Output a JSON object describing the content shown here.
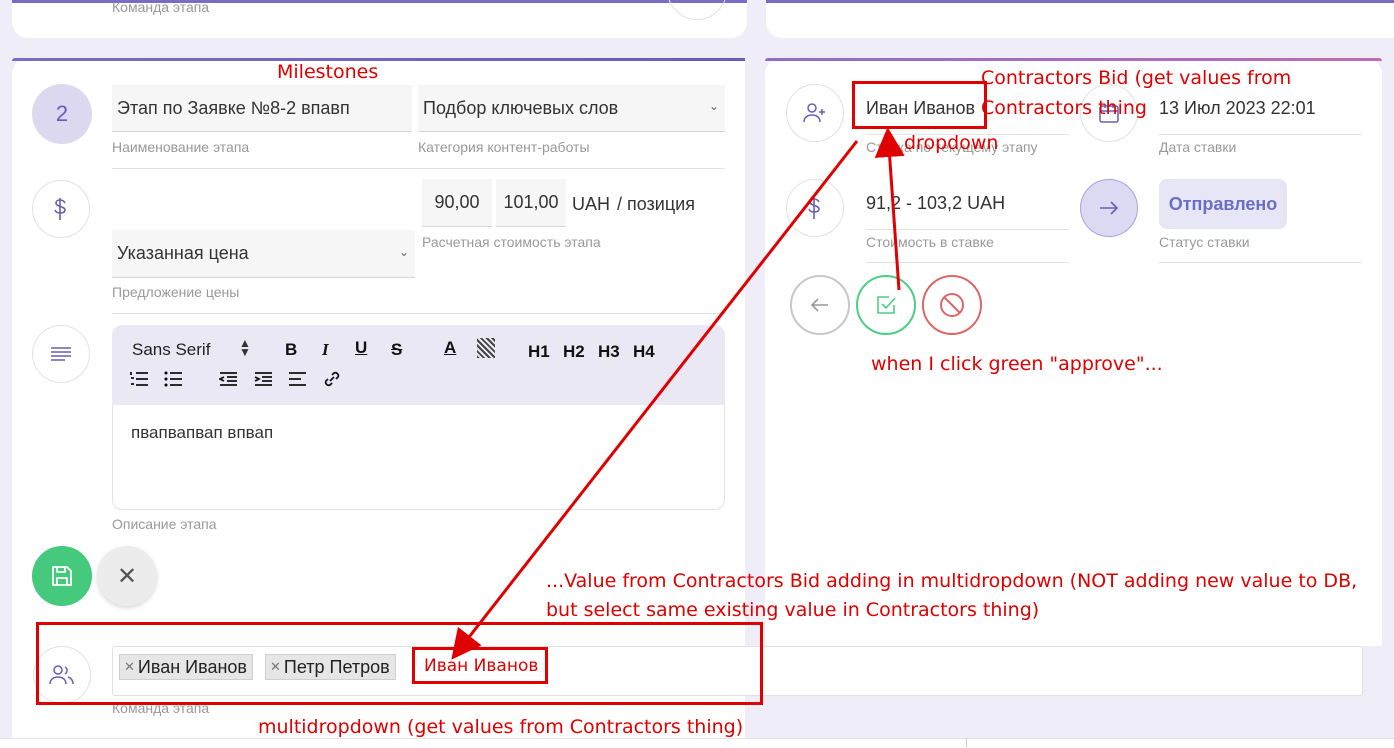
{
  "top": {
    "left_label": "Команда этапа"
  },
  "milestones": {
    "number": "2",
    "name_value": "Этап по Заявке №8-2 впавп",
    "name_label": "Наименование этапа",
    "category_value": "Подбор ключевых слов",
    "category_label": "Категория контент-работы",
    "price_min": "90,00",
    "price_max": "101,00",
    "currency": "UAH",
    "per_unit": "/ позиция",
    "cost_label": "Расчетная стоимость этапа",
    "price_offer_value": "Указанная цена",
    "price_offer_label": "Предложение цены",
    "editor": {
      "font": "Sans Serif",
      "bold": "B",
      "italic": "I",
      "underline": "U",
      "strike": "S",
      "color": "A",
      "h1": "H1",
      "h2": "H2",
      "h3": "H3",
      "h4": "H4",
      "content": "пвапвапвап впвап"
    },
    "description_label": "Описание этапа"
  },
  "bid": {
    "contractor_value": "Иван Иванов",
    "contractor_label": "Ставка по текущему этапу",
    "date_value": "13 Июл 2023 22:01",
    "date_label": "Дата ставки",
    "cost_value": "91,2 - 103,2 UAH",
    "cost_label": "Стоимость в ставке",
    "status_value": "Отправлено",
    "status_label": "Статус ставки"
  },
  "team": {
    "tags": [
      "Иван Иванов",
      "Петр Петров"
    ],
    "added_value": "Иван Иванов",
    "label": "Команда этапа"
  },
  "annotations": {
    "milestones": "Milestones",
    "contractors_bid": "Contractors Bid (get values from Contractors thing",
    "dropdown": "dropdown",
    "approve": "when I click green \"approve\"...",
    "value_line1": "...Value from Contractors Bid adding in multidropdown (NOT adding new value to DB,",
    "value_line2": "but select same existing value in Contractors thing)",
    "multidropdown": "multidropdown (get values from Contractors thing)"
  },
  "colors": {
    "accent_purple": "#7a6cc4",
    "approve_green": "#4ccf84",
    "reject_red": "#e06666",
    "save_green": "#45c97c",
    "status_badge": "#e6e6f7",
    "annotation_red": "#e00000"
  },
  "icons": {
    "stage_amount": "dollar-icon",
    "description": "text-lines-icon",
    "contractor": "user-plus-icon",
    "date": "calendar-icon",
    "bid_cost": "dollar-icon",
    "status": "arrow-right-icon",
    "back": "arrow-left-icon",
    "approve": "check-square-icon",
    "reject": "ban-icon",
    "save": "floppy-icon",
    "close": "close-icon",
    "team": "users-icon"
  }
}
